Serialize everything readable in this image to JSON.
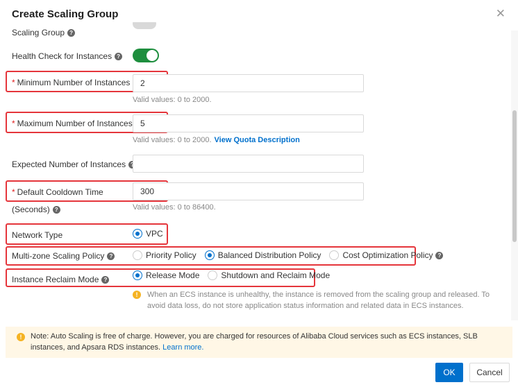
{
  "dialog": {
    "title": "Create Scaling Group"
  },
  "fields": {
    "scaling_group": {
      "label": "Scaling Group"
    },
    "health_check": {
      "label": "Health Check for Instances",
      "enabled": true
    },
    "min_instances": {
      "label": "Minimum Number of Instances",
      "value": "2",
      "hint": "Valid values: 0 to 2000."
    },
    "max_instances": {
      "label": "Maximum Number of Instances",
      "value": "5",
      "hint": "Valid values: 0 to 2000.",
      "link": "View Quota Description"
    },
    "expected_instances": {
      "label": "Expected Number of Instances",
      "value": ""
    },
    "cooldown": {
      "label": "Default Cooldown Time",
      "label2": "(Seconds)",
      "value": "300",
      "hint": "Valid values: 0 to 86400."
    },
    "network_type": {
      "label": "Network Type",
      "options": [
        "VPC"
      ],
      "selected": "VPC"
    },
    "multizone": {
      "label": "Multi-zone Scaling Policy",
      "options": [
        "Priority Policy",
        "Balanced Distribution Policy",
        "Cost Optimization Policy"
      ],
      "selected": "Balanced Distribution Policy"
    },
    "reclaim": {
      "label": "Instance Reclaim Mode",
      "options": [
        "Release Mode",
        "Shutdown and Reclaim Mode"
      ],
      "selected": "Release Mode",
      "note": "When an ECS instance is unhealthy, the instance is removed from the scaling group and released. To avoid data loss, do not store application status information and related data in ECS instances."
    }
  },
  "notice": {
    "text": "Note: Auto Scaling is free of charge. However, you are charged for resources of Alibaba Cloud services such as ECS instances, SLB instances, and Apsara RDS instances.",
    "link": "Learn more."
  },
  "footer": {
    "ok": "OK",
    "cancel": "Cancel"
  },
  "icons": {
    "close": "close-icon",
    "help": "help-circle-icon",
    "warning": "warning-icon"
  },
  "colors": {
    "primary": "#0070cc",
    "switch_on": "#1e8e3e",
    "highlight": "#e5353b",
    "required": "#e02020",
    "notice_bg": "#fff7e6"
  }
}
